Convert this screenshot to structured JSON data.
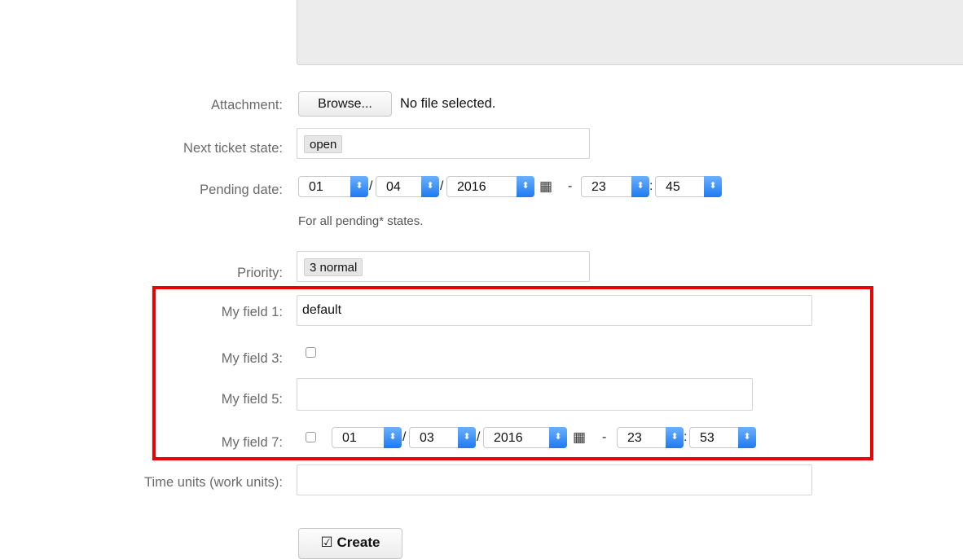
{
  "attachment": {
    "label": "Attachment:",
    "browse_label": "Browse...",
    "status": "No file selected."
  },
  "next_state": {
    "label": "Next ticket state:",
    "value": "open"
  },
  "pending": {
    "label": "Pending date:",
    "day": "01",
    "month": "04",
    "year": "2016",
    "hour": "23",
    "minute": "45",
    "slash": "/",
    "dash": "-",
    "colon": ":",
    "hint": "For all pending* states."
  },
  "priority": {
    "label": "Priority:",
    "value": "3 normal"
  },
  "field1": {
    "label": "My field 1:",
    "value": "default"
  },
  "field3": {
    "label": "My field 3:"
  },
  "field5": {
    "label": "My field 5:",
    "value": ""
  },
  "field7": {
    "label": "My field 7:",
    "day": "01",
    "month": "03",
    "year": "2016",
    "hour": "23",
    "minute": "53"
  },
  "time_units": {
    "label": "Time units (work units):",
    "value": ""
  },
  "create_label": "Create",
  "colors": {
    "highlight": "#ee0000",
    "spinner": "#1f7af0"
  },
  "icons": [
    "calendar-icon",
    "check-square-icon",
    "updown-chevron-icon"
  ]
}
